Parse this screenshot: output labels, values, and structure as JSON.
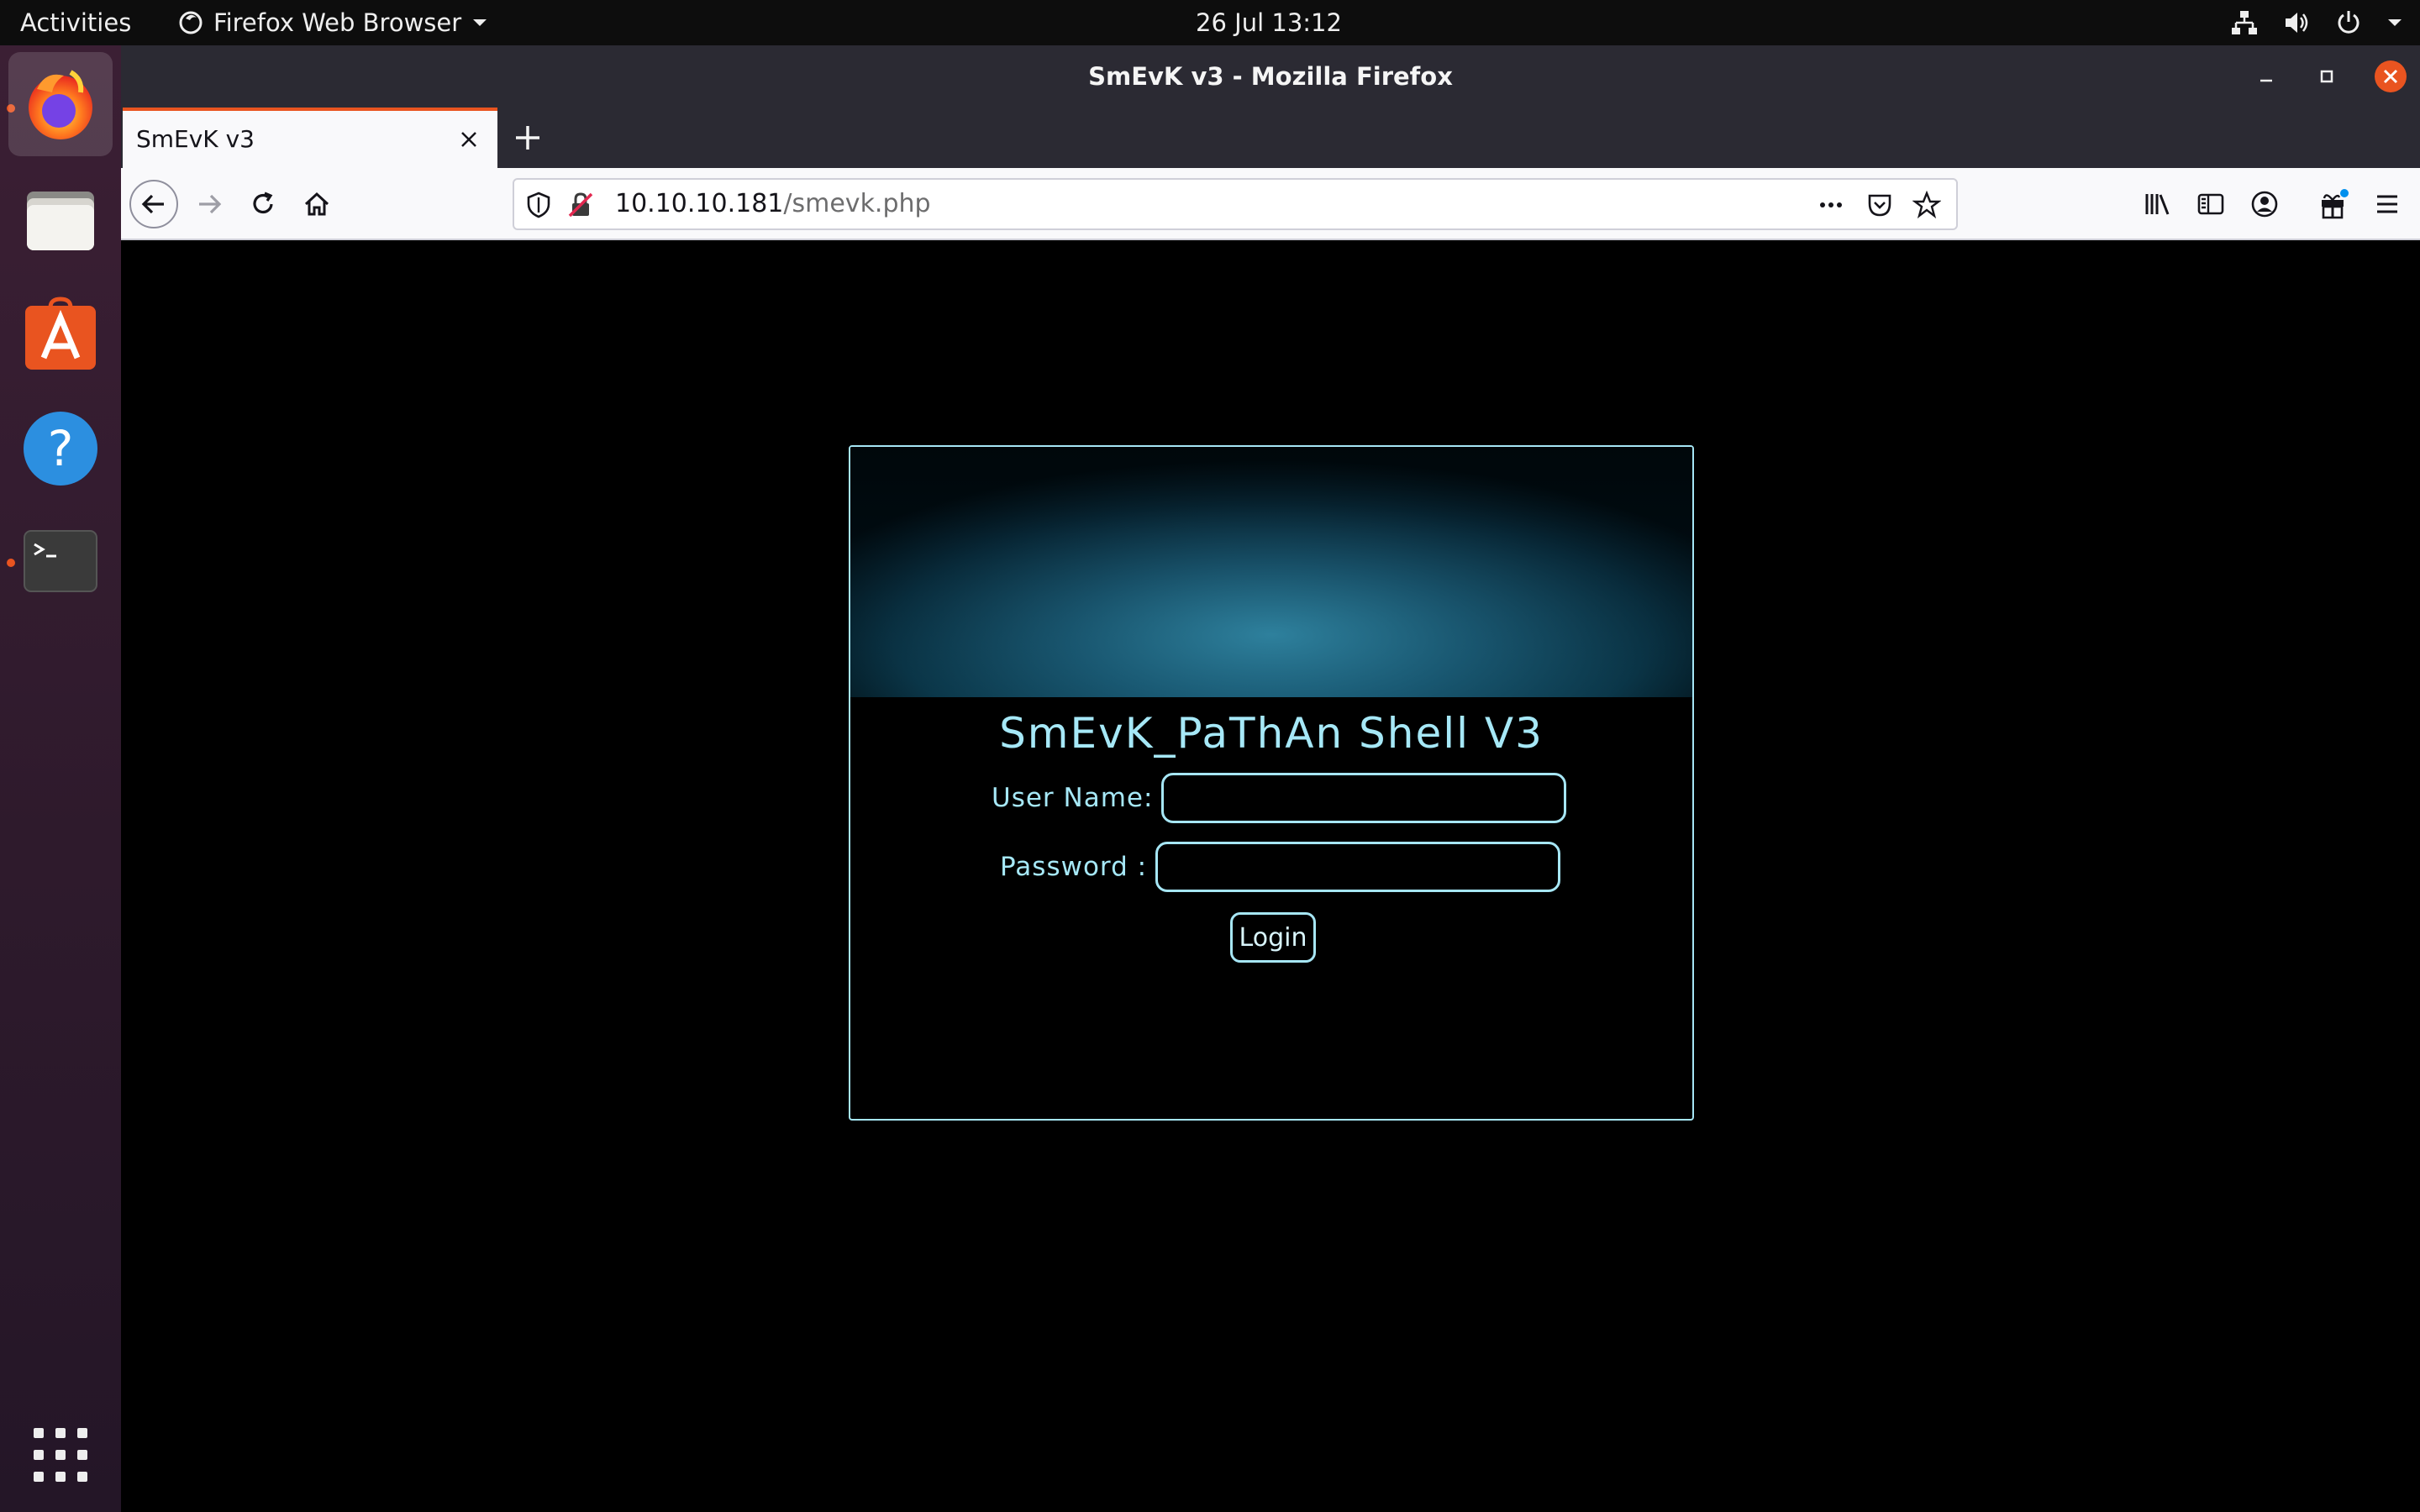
{
  "topbar": {
    "activities": "Activities",
    "app_name": "Firefox Web Browser",
    "clock": "26 Jul  13:12"
  },
  "dock": {
    "items": [
      "firefox-icon",
      "files-icon",
      "software-center-icon",
      "help-icon",
      "terminal-icon"
    ],
    "apps_grid_icon": "show-applications-icon"
  },
  "window": {
    "title": "SmEvK v3 - Mozilla Firefox"
  },
  "tabs": [
    {
      "title": "SmEvK v3",
      "active": true
    }
  ],
  "navbar": {
    "url_host": "10.10.10.181",
    "url_path": "/smevk.php"
  },
  "login": {
    "title": "SmEvK_PaThAn Shell V3",
    "username_label": "User Name:",
    "password_label": "Password :",
    "username_value": "",
    "password_value": "",
    "button_label": "Login"
  },
  "colors": {
    "accent": "#a6e6f5",
    "ubuntu_orange": "#e95420",
    "titlebar": "#2b2a33"
  }
}
